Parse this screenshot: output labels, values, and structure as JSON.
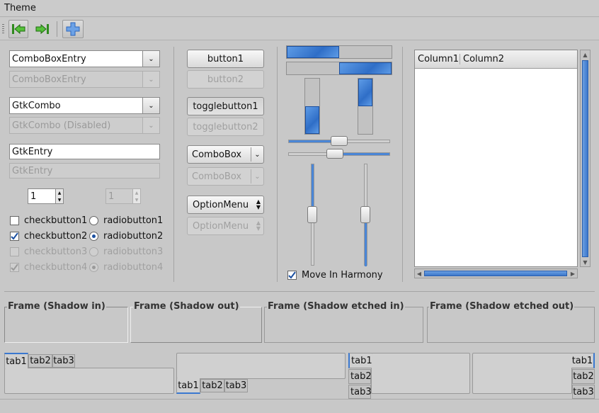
{
  "menubar": {
    "items": [
      "Theme"
    ]
  },
  "combos": {
    "entry1": "ComboBoxEntry",
    "entry2": "ComboBoxEntry",
    "gtk1": "GtkCombo",
    "gtk2": "GtkCombo (Disabled)"
  },
  "entries": {
    "e1": "GtkEntry",
    "e2": "GtkEntry"
  },
  "spins": {
    "s1": "1",
    "s2": "1"
  },
  "checks": {
    "c1": "checkbutton1",
    "c2": "checkbutton2",
    "c3": "checkbutton3",
    "c4": "checkbutton4"
  },
  "radios": {
    "r1": "radiobutton1",
    "r2": "radiobutton2",
    "r3": "radiobutton3",
    "r4": "radiobutton4"
  },
  "buttons": {
    "b1": "button1",
    "b2": "button2",
    "t1": "togglebutton1",
    "t2": "togglebutton2",
    "cb1": "ComboBox",
    "cb2": "ComboBox",
    "om1": "OptionMenu",
    "om2": "OptionMenu"
  },
  "progress": {
    "h1": 0.5,
    "h2": 0.5,
    "v1": 0.5,
    "v2": 0.5
  },
  "scales": {
    "h1": 0.5,
    "h2": 0.5,
    "v1": 0.5,
    "v2": 0.5
  },
  "harmony": {
    "label": "Move In Harmony",
    "checked": true
  },
  "tree": {
    "columns": [
      "Column1",
      "Column2"
    ]
  },
  "frames": [
    "Frame (Shadow in)",
    "Frame (Shadow out)",
    "Frame (Shadow etched in)",
    "Frame (Shadow etched out)"
  ],
  "tabs": [
    "tab1",
    "tab2",
    "tab3"
  ],
  "colors": {
    "accent": "#3a78d0",
    "bg": "#c8c8c8"
  }
}
